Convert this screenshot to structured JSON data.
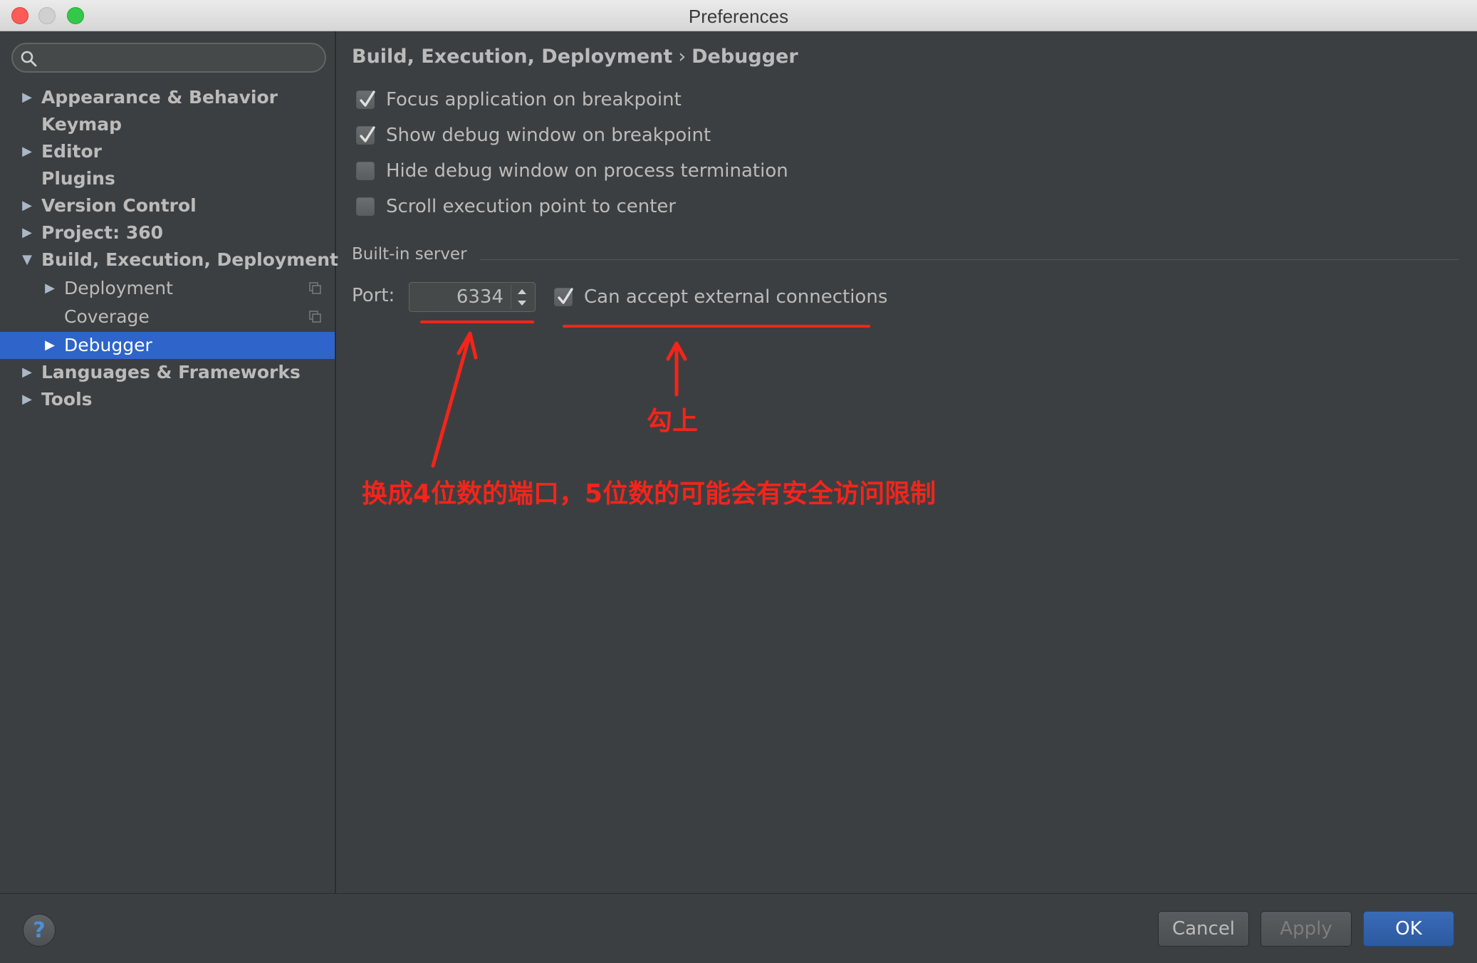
{
  "window": {
    "title": "Preferences"
  },
  "search": {
    "placeholder": ""
  },
  "sidebar": {
    "items": [
      {
        "label": "Appearance & Behavior",
        "has_arrow": true,
        "expanded": false
      },
      {
        "label": "Keymap",
        "has_arrow": false
      },
      {
        "label": "Editor",
        "has_arrow": true,
        "expanded": false
      },
      {
        "label": "Plugins",
        "has_arrow": false
      },
      {
        "label": "Version Control",
        "has_arrow": true,
        "expanded": false
      },
      {
        "label": "Project: 360",
        "has_arrow": true,
        "expanded": false
      },
      {
        "label": "Build, Execution, Deployment",
        "has_arrow": true,
        "expanded": true
      },
      {
        "label": "Deployment",
        "has_arrow": true,
        "expanded": false
      },
      {
        "label": "Coverage",
        "has_arrow": false
      },
      {
        "label": "Debugger",
        "has_arrow": true,
        "expanded": false,
        "selected": true
      },
      {
        "label": "Languages & Frameworks",
        "has_arrow": true,
        "expanded": false
      },
      {
        "label": "Tools",
        "has_arrow": true,
        "expanded": false
      }
    ]
  },
  "breadcrumb": {
    "parent": "Build, Execution, Deployment",
    "separator": "›",
    "current": "Debugger"
  },
  "options": [
    {
      "label": "Focus application on breakpoint",
      "checked": true
    },
    {
      "label": "Show debug window on breakpoint",
      "checked": true
    },
    {
      "label": "Hide debug window on process termination",
      "checked": false
    },
    {
      "label": "Scroll execution point to center",
      "checked": false
    }
  ],
  "builtin_server": {
    "title": "Built-in server",
    "port_label": "Port:",
    "port_value": "6334",
    "external_label": "Can accept external connections",
    "external_checked": true
  },
  "annotations": {
    "check_it": "勾上",
    "port_note": "换成4位数的端口，5位数的可能会有安全访问限制",
    "color": "#f5241a"
  },
  "footer": {
    "help": "?",
    "cancel": "Cancel",
    "apply": "Apply",
    "ok": "OK"
  }
}
